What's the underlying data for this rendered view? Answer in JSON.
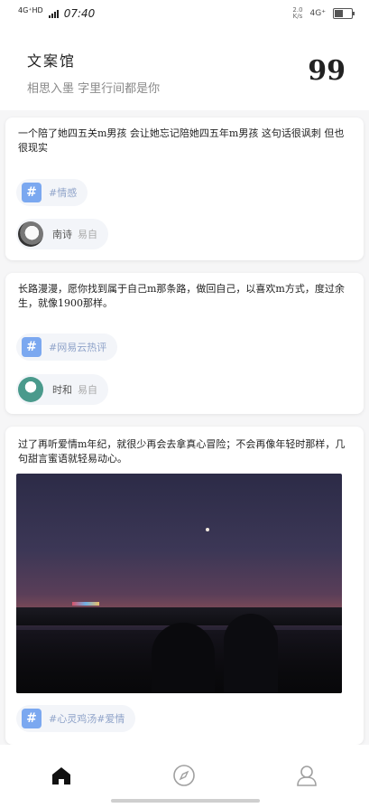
{
  "status_bar": {
    "signal_label": "4G⁺HD",
    "time": "07:40",
    "netspeed": "2.0\nK/s",
    "network": "4G⁺",
    "battery_level": 0.55
  },
  "header": {
    "title": "文案馆",
    "subtitle": "相思入墨 字里行间都是你",
    "quote_icon": "quote-icon"
  },
  "posts": [
    {
      "text": "一个陪了她四五关m男孩 会让她忘记陪她四五年m男孩 这句话很讽刺 但也很现实",
      "tag": "#情感",
      "author": "南诗",
      "source": "易自"
    },
    {
      "text": "长路漫漫，愿你找到属于自己m那条路，做回自己，以喜欢m方式，度过余生，就像1900那样。",
      "tag": "#网易云热评",
      "author": "时和",
      "source": "易自"
    },
    {
      "text": "过了再听爱情m年纪，就很少再会去拿真心冒险；不会再像年轻时那样，几句甜言蜜语就轻易动心。",
      "tag": "#心灵鸡汤#爱情",
      "has_image": true
    }
  ],
  "nav": {
    "items": [
      {
        "name": "home",
        "icon": "home-icon",
        "active": true
      },
      {
        "name": "discover",
        "icon": "compass-icon",
        "active": false
      },
      {
        "name": "profile",
        "icon": "user-icon",
        "active": false
      }
    ]
  },
  "colors": {
    "accent": "#7ba8f0",
    "tag_text": "#8fa3c9",
    "pill_bg": "#f3f5f9"
  }
}
